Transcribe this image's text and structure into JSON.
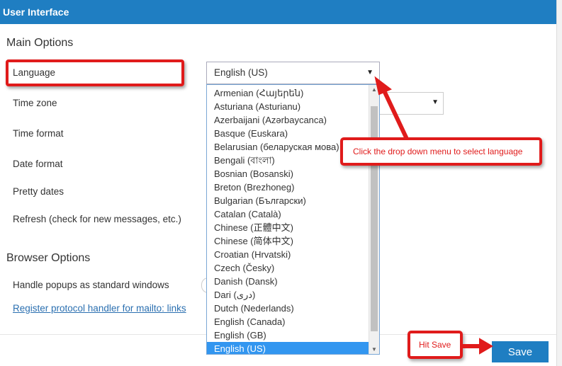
{
  "window": {
    "title": "User Interface"
  },
  "main_options": {
    "heading": "Main Options",
    "labels": {
      "language": "Language",
      "time_zone": "Time zone",
      "time_format": "Time format",
      "date_format": "Date format",
      "pretty_dates": "Pretty dates",
      "refresh": "Refresh (check for new messages, etc.)"
    }
  },
  "browser_options": {
    "heading": "Browser Options",
    "handle_popups": "Handle popups as standard windows",
    "register_link": "Register protocol handler for mailto: links"
  },
  "language_select": {
    "selected": "English (US)",
    "options": [
      "Armenian (Հայերեն)",
      "Asturiana (Asturianu)",
      "Azerbaijani (Azərbaycanca)",
      "Basque (Euskara)",
      "Belarusian (беларуская мова)",
      "Bengali (বাংলা)",
      "Bosnian (Bosanski)",
      "Breton (Brezhoneg)",
      "Bulgarian (Български)",
      "Catalan (Català)",
      "Chinese (正體中文)",
      "Chinese (简体中文)",
      "Croatian (Hrvatski)",
      "Czech (Česky)",
      "Danish (Dansk)",
      "Dari (دری)",
      "Dutch (Nederlands)",
      "English (Canada)",
      "English (GB)",
      "English (US)"
    ]
  },
  "annotations": {
    "dropdown_note": "Click the drop down menu to select language",
    "save_note": "Hit Save"
  },
  "buttons": {
    "save": "Save"
  },
  "colors": {
    "accent": "#1f7ec2",
    "callout": "#e01b1b",
    "selected_option": "#3296f0"
  },
  "icons": {
    "caret": "caret-down-icon"
  }
}
